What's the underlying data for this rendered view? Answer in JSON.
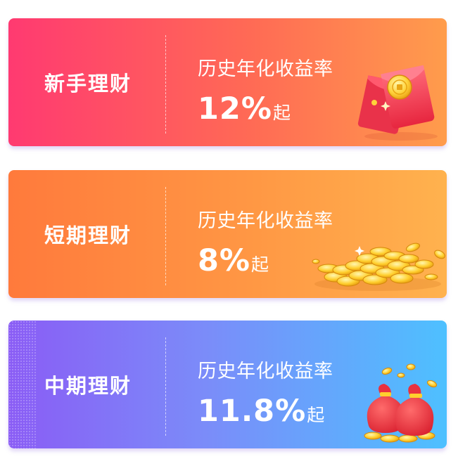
{
  "cards": [
    {
      "name": "新手理财",
      "rate_label": "历史年化收益率",
      "rate_value": "12%",
      "rate_suffix": "起",
      "decoration": "red-envelope-icon"
    },
    {
      "name": "短期理财",
      "rate_label": "历史年化收益率",
      "rate_value": "8%",
      "rate_suffix": "起",
      "decoration": "gold-coins-icon"
    },
    {
      "name": "中期理财",
      "rate_label": "历史年化收益率",
      "rate_value": "11.8%",
      "rate_suffix": "起",
      "decoration": "money-bag-icon"
    }
  ],
  "colors": {
    "card_0_gradient": [
      "#ff3a71",
      "#ff9c4c"
    ],
    "card_1_gradient": [
      "#ff7a3c",
      "#ffb24e"
    ],
    "card_2_gradient": [
      "#8a5cf5",
      "#4ec0ff"
    ],
    "text": "#ffffff"
  }
}
